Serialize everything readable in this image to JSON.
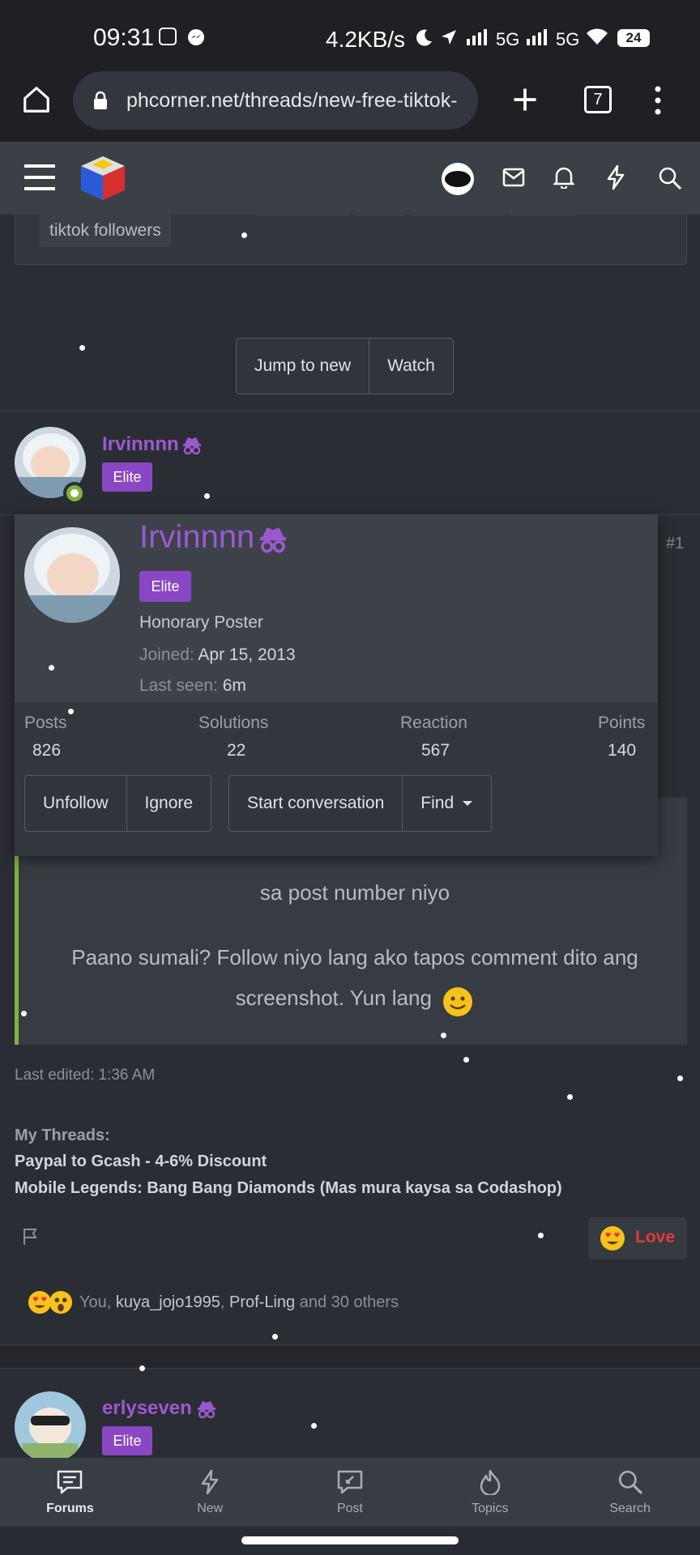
{
  "status_bar": {
    "time": "09:31",
    "speed": "4.2KB/s",
    "net1": "5G",
    "net2": "5G",
    "battery": "24"
  },
  "browser": {
    "url": "phcorner.net/threads/new-free-tiktok-",
    "tab_count": "7"
  },
  "tags": {
    "last": "tiktok followers"
  },
  "thread_actions": {
    "jump_label": "Jump to new",
    "watch_label": "Watch"
  },
  "post1": {
    "author": "Irvinnnn",
    "badge": "Elite",
    "number": "#1",
    "quote_line1": "sa post number niyo",
    "quote_line2": "Paano sumali? Follow niyo lang ako tapos comment dito ang",
    "quote_line3": "screenshot. Yun lang",
    "last_edited": "Last edited: 1:36 AM",
    "signature_title": "My Threads:",
    "signature_link1": "Paypal to Gcash - 4-6% Discount",
    "signature_link2": "Mobile Legends: Bang Bang Diamonds (Mas mura kaysa sa Codashop)",
    "reaction_label": "Love",
    "reactions_you": "You,",
    "reactions_user1": "kuya_jojo1995",
    "reactions_sep": ",",
    "reactions_user2": "Prof-Ling",
    "reactions_rest": "and 30 others"
  },
  "member_card": {
    "name": "Irvinnnn",
    "badge": "Elite",
    "title": "Honorary Poster",
    "joined_label": "Joined:",
    "joined_value": "Apr 15, 2013",
    "last_seen_label": "Last seen:",
    "last_seen_value": "6m",
    "stats": [
      {
        "label": "Posts",
        "value": "826"
      },
      {
        "label": "Solutions",
        "value": "22"
      },
      {
        "label": "Reaction",
        "value": "567"
      },
      {
        "label": "Points",
        "value": "140"
      }
    ],
    "buttons": {
      "unfollow": "Unfollow",
      "ignore": "Ignore",
      "start_conversation": "Start conversation",
      "find": "Find"
    }
  },
  "post2": {
    "author": "erlyseven",
    "badge": "Elite"
  },
  "bottom_nav": [
    {
      "label": "Forums",
      "icon": "forums-icon"
    },
    {
      "label": "New",
      "icon": "bolt-icon"
    },
    {
      "label": "Post",
      "icon": "post-icon"
    },
    {
      "label": "Topics",
      "icon": "fire-icon"
    },
    {
      "label": "Search",
      "icon": "search-icon"
    }
  ],
  "colors": {
    "username": "#9b59d0",
    "elite_badge": "#8a47c4",
    "quote_border": "#7cb342",
    "love": "#e53935"
  }
}
